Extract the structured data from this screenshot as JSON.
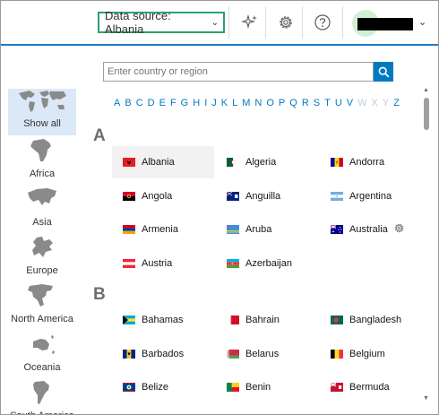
{
  "toolbar": {
    "data_source_label": "Data source: Albania",
    "data_source_chevron": "⌄",
    "icons": [
      "sparkle-icon",
      "gear-icon",
      "help-icon"
    ],
    "user_chevron": "⌄"
  },
  "search": {
    "placeholder": "Enter country or region"
  },
  "alphabet": [
    {
      "l": "A",
      "enabled": true
    },
    {
      "l": "B",
      "enabled": true
    },
    {
      "l": "C",
      "enabled": true
    },
    {
      "l": "D",
      "enabled": true
    },
    {
      "l": "E",
      "enabled": true
    },
    {
      "l": "F",
      "enabled": true
    },
    {
      "l": "G",
      "enabled": true
    },
    {
      "l": "H",
      "enabled": true
    },
    {
      "l": "I",
      "enabled": true
    },
    {
      "l": "J",
      "enabled": true
    },
    {
      "l": "K",
      "enabled": true
    },
    {
      "l": "L",
      "enabled": true
    },
    {
      "l": "M",
      "enabled": true
    },
    {
      "l": "N",
      "enabled": true
    },
    {
      "l": "O",
      "enabled": true
    },
    {
      "l": "P",
      "enabled": true
    },
    {
      "l": "Q",
      "enabled": true
    },
    {
      "l": "R",
      "enabled": true
    },
    {
      "l": "S",
      "enabled": true
    },
    {
      "l": "T",
      "enabled": true
    },
    {
      "l": "U",
      "enabled": true
    },
    {
      "l": "V",
      "enabled": true
    },
    {
      "l": "W",
      "enabled": false
    },
    {
      "l": "X",
      "enabled": false
    },
    {
      "l": "Y",
      "enabled": false
    },
    {
      "l": "Z",
      "enabled": true
    }
  ],
  "regions": [
    {
      "key": "show-all",
      "label": "Show all",
      "selected": true
    },
    {
      "key": "africa",
      "label": "Africa",
      "selected": false
    },
    {
      "key": "asia",
      "label": "Asia",
      "selected": false
    },
    {
      "key": "europe",
      "label": "Europe",
      "selected": false
    },
    {
      "key": "north-america",
      "label": "North America",
      "selected": false
    },
    {
      "key": "oceania",
      "label": "Oceania",
      "selected": false
    },
    {
      "key": "south-america",
      "label": "South America",
      "selected": false
    }
  ],
  "groups": [
    {
      "letter": "A",
      "countries": [
        {
          "name": "Albania",
          "selected": true,
          "flag": "albania"
        },
        {
          "name": "Algeria",
          "selected": false,
          "flag": "algeria"
        },
        {
          "name": "Andorra",
          "selected": false,
          "flag": "andorra"
        },
        {
          "name": "Angola",
          "selected": false,
          "flag": "angola"
        },
        {
          "name": "Anguilla",
          "selected": false,
          "flag": "anguilla"
        },
        {
          "name": "Argentina",
          "selected": false,
          "flag": "argentina"
        },
        {
          "name": "Armenia",
          "selected": false,
          "flag": "armenia"
        },
        {
          "name": "Aruba",
          "selected": false,
          "flag": "aruba"
        },
        {
          "name": "Australia",
          "selected": false,
          "flag": "australia",
          "settings": true
        },
        {
          "name": "Austria",
          "selected": false,
          "flag": "austria"
        },
        {
          "name": "Azerbaijan",
          "selected": false,
          "flag": "azerbaijan"
        }
      ]
    },
    {
      "letter": "B",
      "countries": [
        {
          "name": "Bahamas",
          "selected": false,
          "flag": "bahamas"
        },
        {
          "name": "Bahrain",
          "selected": false,
          "flag": "bahrain"
        },
        {
          "name": "Bangladesh",
          "selected": false,
          "flag": "bangladesh"
        },
        {
          "name": "Barbados",
          "selected": false,
          "flag": "barbados"
        },
        {
          "name": "Belarus",
          "selected": false,
          "flag": "belarus"
        },
        {
          "name": "Belgium",
          "selected": false,
          "flag": "belgium"
        },
        {
          "name": "Belize",
          "selected": false,
          "flag": "belize"
        },
        {
          "name": "Benin",
          "selected": false,
          "flag": "benin"
        },
        {
          "name": "Bermuda",
          "selected": false,
          "flag": "bermuda"
        }
      ]
    }
  ],
  "scrollbar": {
    "up": "▲",
    "down": "▼"
  }
}
